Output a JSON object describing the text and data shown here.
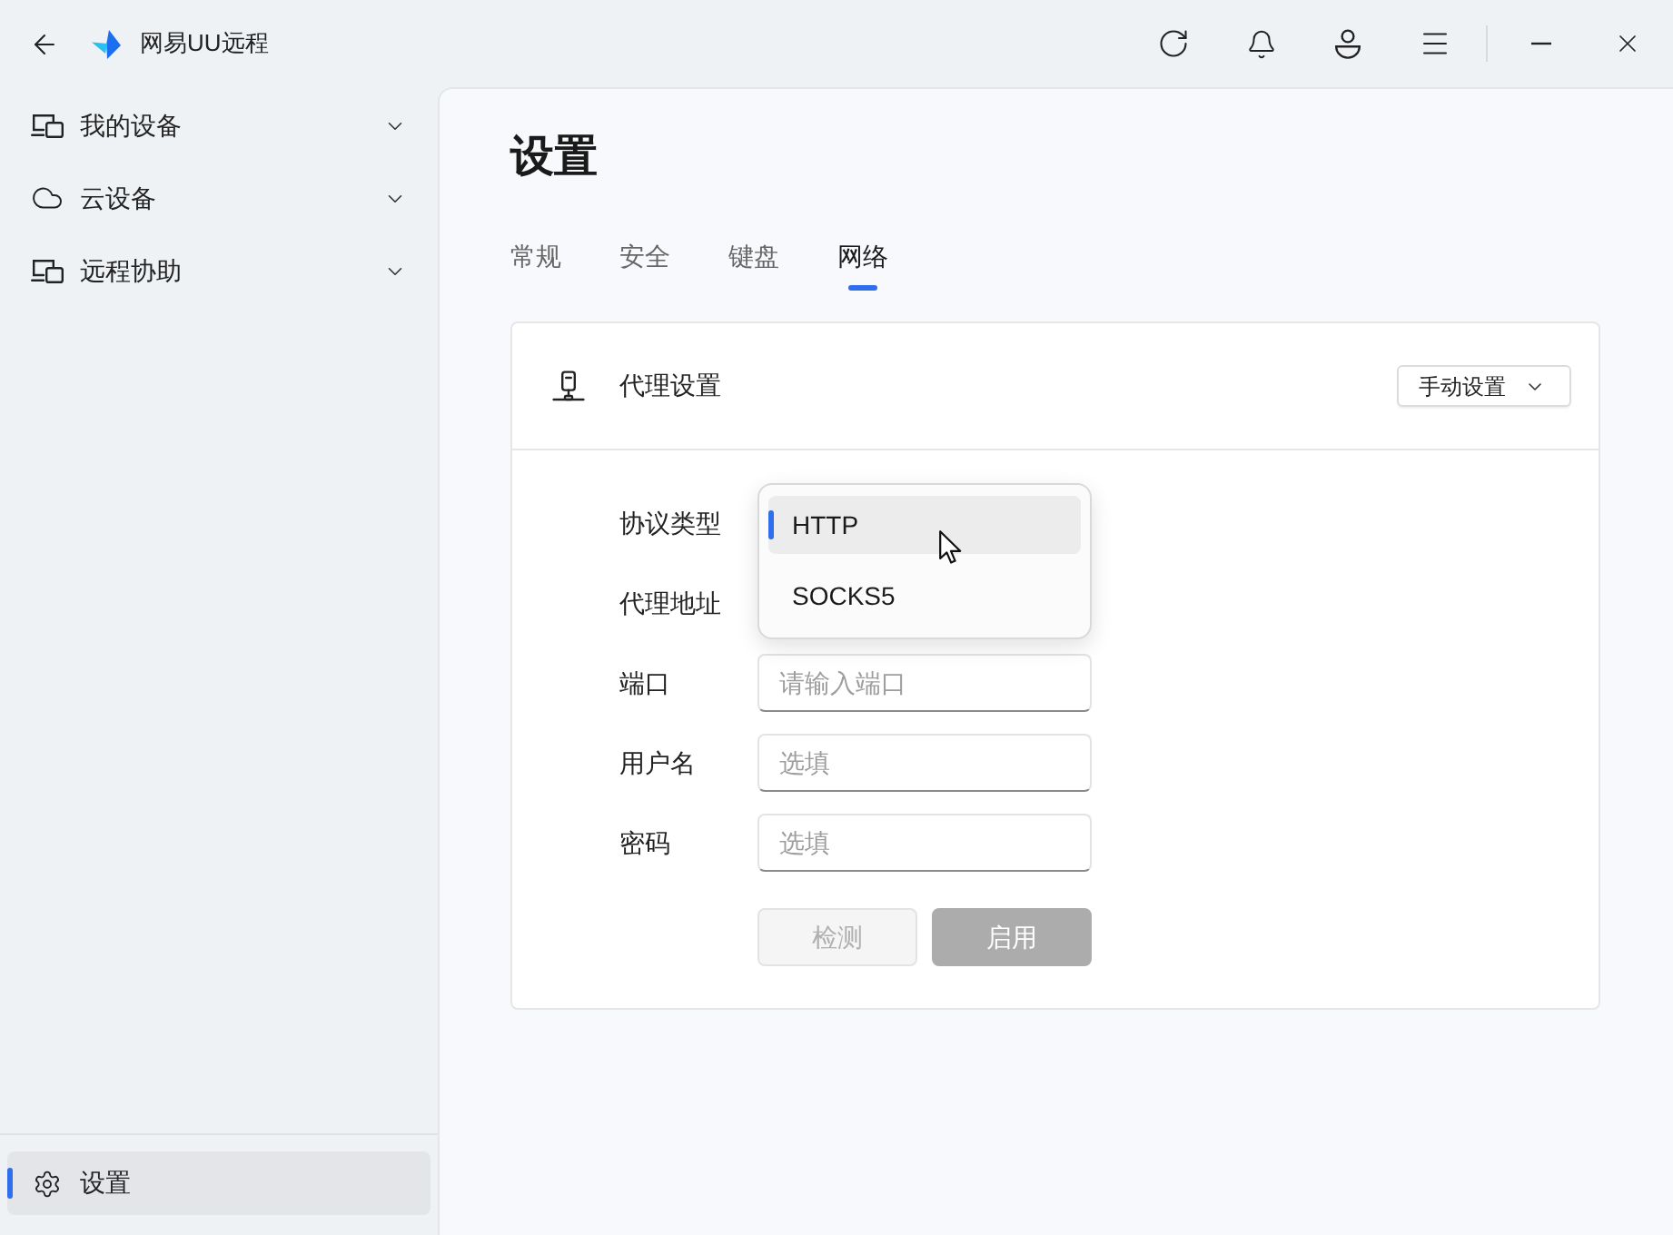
{
  "window": {
    "title": "网易UU远程"
  },
  "sidebar": {
    "items": [
      {
        "label": "我的设备",
        "expanded": false
      },
      {
        "label": "云设备",
        "expanded": false
      },
      {
        "label": "远程协助",
        "expanded": false
      }
    ],
    "footer_item": {
      "label": "设置",
      "selected": true
    }
  },
  "page": {
    "title": "设置"
  },
  "tabs": [
    {
      "label": "常规",
      "selected": false
    },
    {
      "label": "安全",
      "selected": false
    },
    {
      "label": "键盘",
      "selected": false
    },
    {
      "label": "网络",
      "selected": true
    }
  ],
  "proxy_card": {
    "title": "代理设置",
    "mode_select": {
      "value": "手动设置"
    },
    "fields": [
      {
        "label": "协议类型",
        "kind": "select",
        "expanded": true,
        "options": [
          {
            "label": "HTTP",
            "selected": true,
            "hovered": true
          },
          {
            "label": "SOCKS5",
            "selected": false,
            "hovered": false
          }
        ]
      },
      {
        "label": "代理地址",
        "kind": "covered"
      },
      {
        "label": "端口",
        "kind": "input",
        "placeholder": "请输入端口"
      },
      {
        "label": "用户名",
        "kind": "input",
        "placeholder": "选填"
      },
      {
        "label": "密码",
        "kind": "input",
        "placeholder": "选填"
      }
    ],
    "buttons": [
      {
        "label": "检测",
        "kind": "secondary",
        "disabled": true
      },
      {
        "label": "启用",
        "kind": "primary",
        "disabled": true
      }
    ]
  }
}
